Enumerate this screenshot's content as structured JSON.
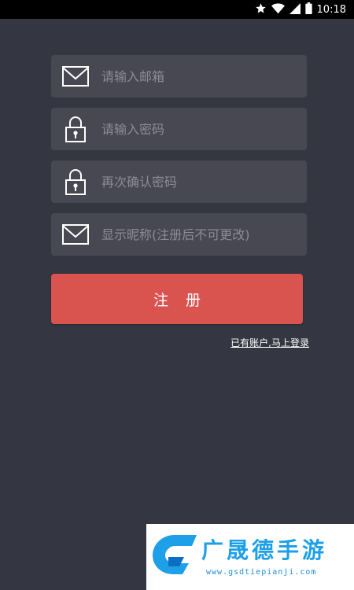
{
  "status_bar": {
    "time": "10:18",
    "icons": [
      "star-icon",
      "wifi-icon",
      "signal-icon",
      "battery-icon"
    ]
  },
  "form": {
    "fields": [
      {
        "name": "email",
        "icon": "mail-icon",
        "placeholder": "请输入邮箱",
        "value": ""
      },
      {
        "name": "password",
        "icon": "lock-icon",
        "placeholder": "请输入密码",
        "value": ""
      },
      {
        "name": "confirm-password",
        "icon": "lock-icon",
        "placeholder": "再次确认密码",
        "value": ""
      },
      {
        "name": "nickname",
        "icon": "mail-icon",
        "placeholder": "显示昵称(注册后不可更改)",
        "value": ""
      }
    ],
    "register_label": "注 册",
    "login_link": "已有账户,马上登录"
  },
  "watermark": {
    "title": "广晟德手游",
    "url": "www.gsdtiepianji.com"
  },
  "colors": {
    "background": "#343641",
    "field_bg": "#474852",
    "button": "#d9534f",
    "watermark_blue": "#1ea0e8"
  }
}
